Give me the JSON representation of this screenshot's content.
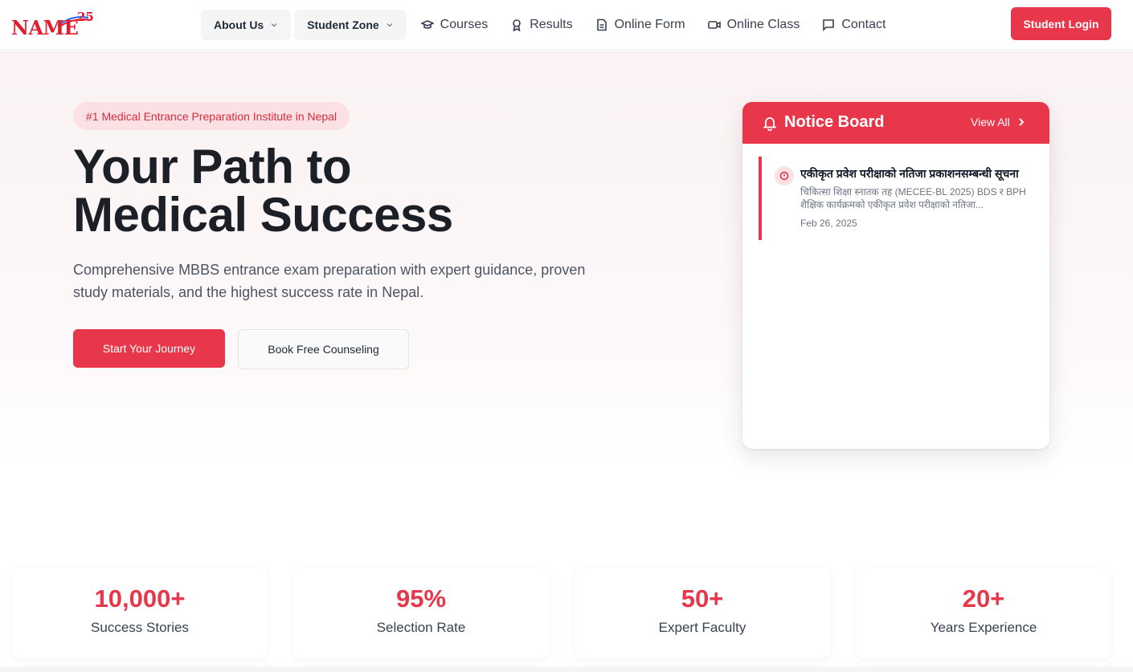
{
  "brand": {
    "logo_text": "NAME",
    "logo_badge": "25"
  },
  "nav": {
    "dropdowns": [
      {
        "label": "About Us"
      },
      {
        "label": "Student Zone"
      }
    ],
    "items": [
      {
        "label": "Courses",
        "icon": "graduation-cap-icon"
      },
      {
        "label": "Results",
        "icon": "award-icon"
      },
      {
        "label": "Online Form",
        "icon": "document-icon"
      },
      {
        "label": "Online Class",
        "icon": "video-icon"
      },
      {
        "label": "Contact",
        "icon": "message-icon"
      }
    ],
    "login_label": "Student Login"
  },
  "hero": {
    "badge": "#1 Medical Entrance Preparation Institute in Nepal",
    "title_line1": "Your Path to",
    "title_line2": "Medical Success",
    "description": "Comprehensive MBBS entrance exam preparation with expert guidance, proven study materials, and the highest success rate in Nepal.",
    "primary_cta": "Start Your Journey",
    "secondary_cta": "Book Free Counseling"
  },
  "notice_board": {
    "title": "Notice Board",
    "view_all": "View All",
    "items": [
      {
        "title": "एकीकृत प्रवेश परीक्षाको नतिजा प्रकाशनसम्बन्धी सूचना",
        "description": "चिकित्सा शिक्षा स्नातक तह (MECEE-BL 2025) BDS र BPH शैक्षिक कार्यक्रमको एकीकृत प्रवेश परीक्षाको नतिजा...",
        "date": "Feb 26, 2025"
      }
    ]
  },
  "stats": [
    {
      "value": "10,000+",
      "label": "Success Stories"
    },
    {
      "value": "95%",
      "label": "Selection Rate"
    },
    {
      "value": "50+",
      "label": "Expert Faculty"
    },
    {
      "value": "20+",
      "label": "Years Experience"
    }
  ],
  "colors": {
    "accent": "#e8374a",
    "badge_bg": "#fbe1e4",
    "text": "#1c1f26"
  }
}
